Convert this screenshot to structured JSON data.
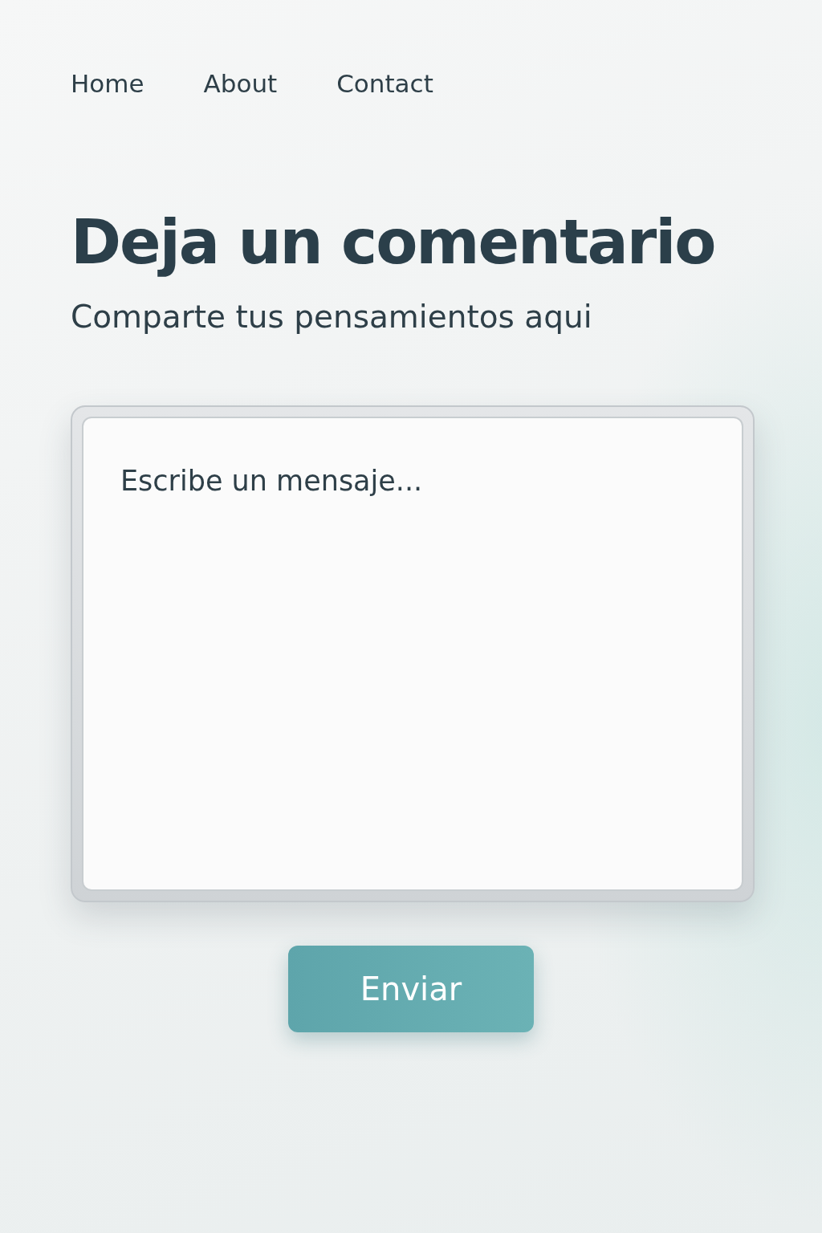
{
  "nav": {
    "links": [
      {
        "label": "Home"
      },
      {
        "label": "About"
      },
      {
        "label": "Contact"
      }
    ]
  },
  "heading": {
    "title": "Deja un comentario",
    "subtitle": "Comparte tus pensamientos aqui"
  },
  "comment": {
    "placeholder": "Escribe un mensaje..."
  },
  "submit": {
    "label": "Enviar"
  }
}
